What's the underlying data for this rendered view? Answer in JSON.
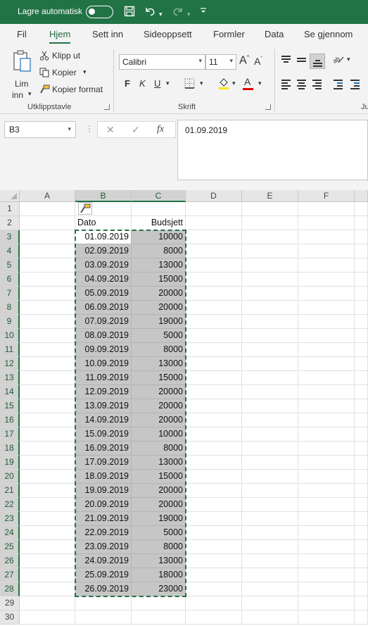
{
  "titlebar": {
    "autosave_label": "Lagre automatisk",
    "autosave_state": "off"
  },
  "tabs": [
    "Fil",
    "Hjem",
    "Sett inn",
    "Sideoppsett",
    "Formler",
    "Data",
    "Se gjennom"
  ],
  "active_tab": "Hjem",
  "ribbon": {
    "paste_label_1": "Lim",
    "paste_label_2": "inn",
    "cut": "Klipp ut",
    "copy": "Kopier",
    "format_painter": "Kopier format",
    "clipboard_group": "Utklippstavle",
    "font_name": "Calibri",
    "font_size": "11",
    "bold": "F",
    "italic": "K",
    "underline": "U",
    "font_group": "Skrift",
    "grow_font": "A",
    "shrink_font": "A",
    "font_color_letter": "A",
    "cut_off_group": "Ju"
  },
  "formula_bar": {
    "name_box": "B3",
    "fx": "fx",
    "formula": "01.09.2019"
  },
  "columns": [
    "A",
    "B",
    "C",
    "D",
    "E",
    "F"
  ],
  "rows": [
    "1",
    "2",
    "3",
    "4",
    "5",
    "6",
    "7",
    "8",
    "9",
    "10",
    "11",
    "12",
    "13",
    "14",
    "15",
    "16",
    "17",
    "18",
    "19",
    "20",
    "21",
    "22",
    "23",
    "24",
    "25",
    "26",
    "27",
    "28",
    "29",
    "30"
  ],
  "headers": {
    "b2": "Dato",
    "c2": "Budsjett"
  },
  "table": [
    {
      "date": "01.09.2019",
      "budget": "10000"
    },
    {
      "date": "02.09.2019",
      "budget": "8000"
    },
    {
      "date": "03.09.2019",
      "budget": "13000"
    },
    {
      "date": "04.09.2019",
      "budget": "15000"
    },
    {
      "date": "05.09.2019",
      "budget": "20000"
    },
    {
      "date": "06.09.2019",
      "budget": "20000"
    },
    {
      "date": "07.09.2019",
      "budget": "19000"
    },
    {
      "date": "08.09.2019",
      "budget": "5000"
    },
    {
      "date": "09.09.2019",
      "budget": "8000"
    },
    {
      "date": "10.09.2019",
      "budget": "13000"
    },
    {
      "date": "11.09.2019",
      "budget": "15000"
    },
    {
      "date": "12.09.2019",
      "budget": "20000"
    },
    {
      "date": "13.09.2019",
      "budget": "20000"
    },
    {
      "date": "14.09.2019",
      "budget": "20000"
    },
    {
      "date": "15.09.2019",
      "budget": "10000"
    },
    {
      "date": "16.09.2019",
      "budget": "8000"
    },
    {
      "date": "17.09.2019",
      "budget": "13000"
    },
    {
      "date": "18.09.2019",
      "budget": "15000"
    },
    {
      "date": "19.09.2019",
      "budget": "20000"
    },
    {
      "date": "20.09.2019",
      "budget": "20000"
    },
    {
      "date": "21.09.2019",
      "budget": "19000"
    },
    {
      "date": "22.09.2019",
      "budget": "5000"
    },
    {
      "date": "23.09.2019",
      "budget": "8000"
    },
    {
      "date": "24.09.2019",
      "budget": "13000"
    },
    {
      "date": "25.09.2019",
      "budget": "18000"
    },
    {
      "date": "26.09.2019",
      "budget": "23000"
    }
  ],
  "colors": {
    "accent": "#217346",
    "selection": "#c6c6c6",
    "font_color_bar": "#e00000",
    "fill_color_bar": "#ffe600"
  }
}
